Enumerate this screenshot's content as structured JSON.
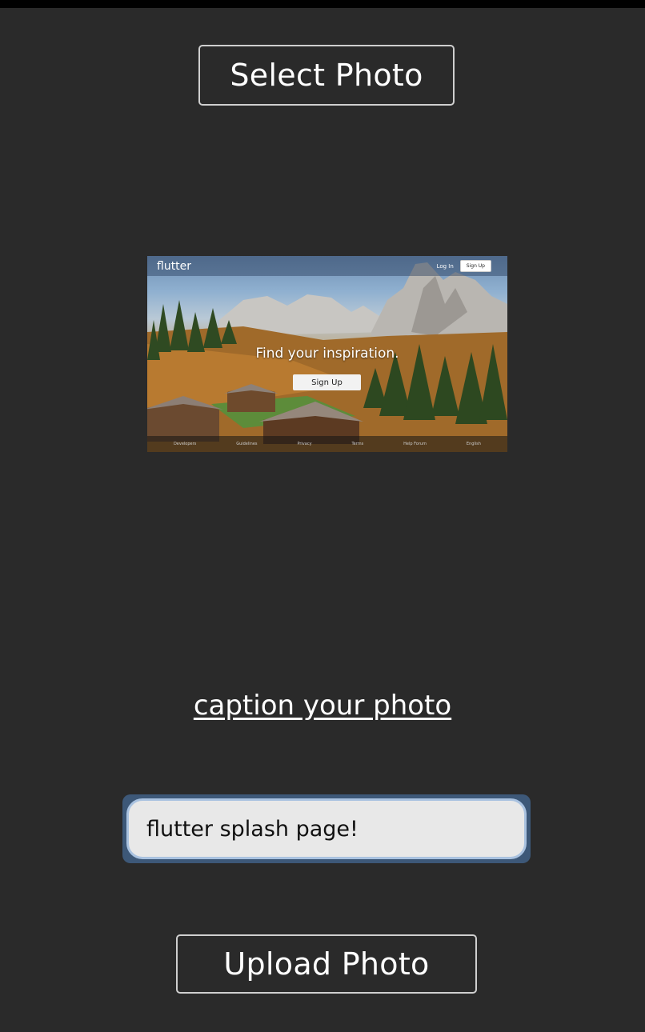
{
  "select_button": {
    "label": "Select Photo"
  },
  "preview": {
    "logo": "flutter",
    "nav_login": "Log In",
    "nav_signup": "Sign Up",
    "headline": "Find your inspiration.",
    "cta": "Sign Up",
    "footer_links": [
      "Developers",
      "Guidelines",
      "Privacy",
      "Terms",
      "Help Forum",
      "English"
    ]
  },
  "caption_link": {
    "label": "caption your photo"
  },
  "caption_input": {
    "value": "flutter splash page!",
    "placeholder": ""
  },
  "upload_button": {
    "label": "Upload Photo"
  },
  "colors": {
    "background": "#2a2a2a",
    "button_border": "#cfcfcf",
    "input_focus": "#3d5878",
    "input_bg": "#e8e8e8"
  }
}
